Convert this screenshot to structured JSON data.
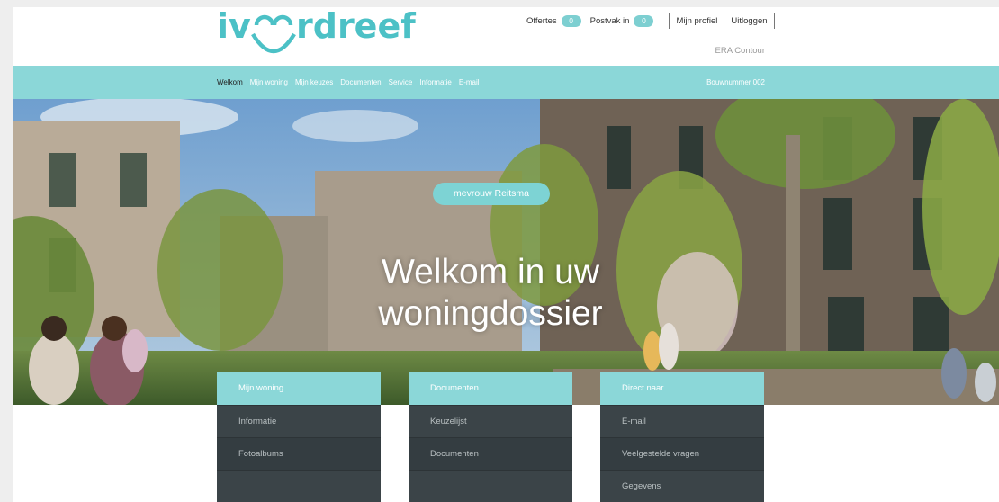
{
  "brand": {
    "logo_text": "ivoordreef",
    "accent": "#8bd7d8",
    "logo_color": "#4cc1c6"
  },
  "header": {
    "offertes_label": "Offertes",
    "offertes_count": "0",
    "postvak_label": "Postvak in",
    "postvak_count": "0",
    "profile_label": "Mijn profiel",
    "logout_label": "Uitloggen",
    "project_name": "ERA Contour"
  },
  "nav": {
    "items": [
      {
        "label": "Welkom"
      },
      {
        "label": "Mijn woning"
      },
      {
        "label": "Mijn keuzes"
      },
      {
        "label": "Documenten"
      },
      {
        "label": "Service"
      },
      {
        "label": "Informatie"
      },
      {
        "label": "E-mail"
      }
    ],
    "bouwnummer": "Bouwnummer 002"
  },
  "hero": {
    "name_pill": "mevrouw Reitsma",
    "title_line1": "Welkom in uw",
    "title_line2": "woningdossier"
  },
  "cards": [
    {
      "title": "Mijn woning",
      "items": [
        "Informatie",
        "Fotoalbums",
        ""
      ]
    },
    {
      "title": "Documenten",
      "items": [
        "Keuzelijst",
        "Documenten",
        ""
      ]
    },
    {
      "title": "Direct naar",
      "items": [
        "E-mail",
        "Veelgestelde vragen",
        "Gegevens"
      ]
    }
  ]
}
